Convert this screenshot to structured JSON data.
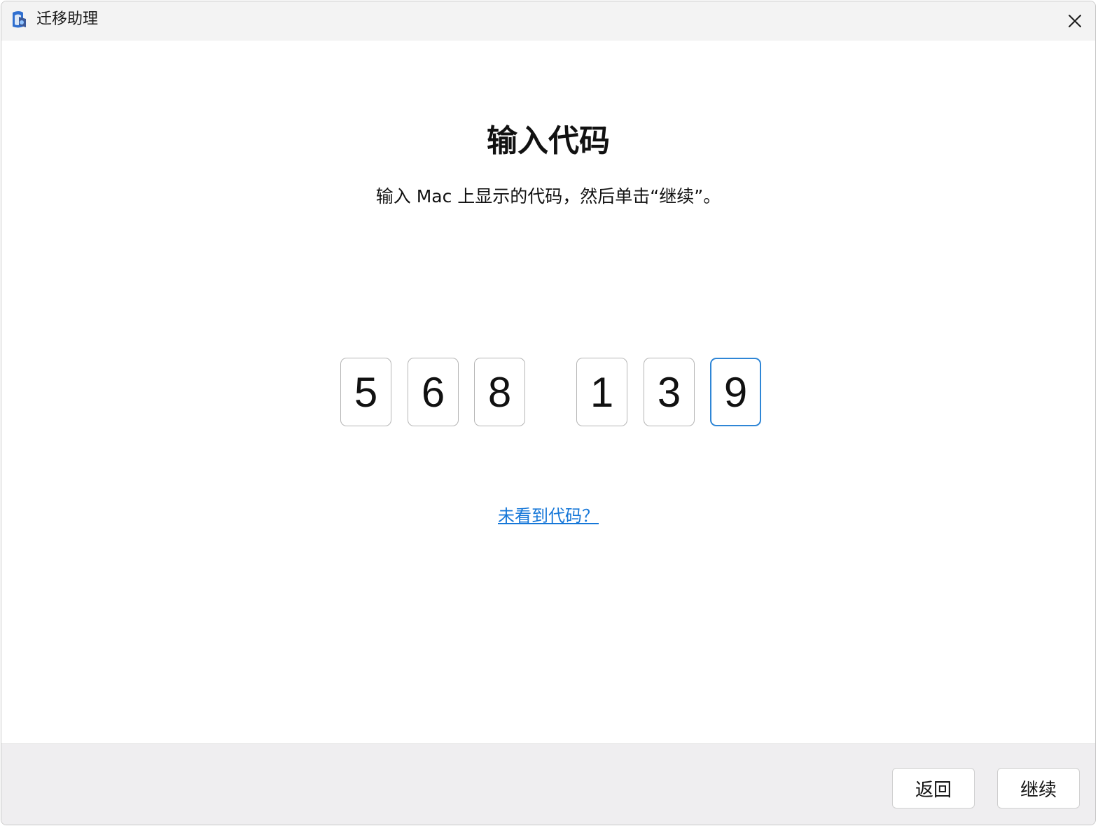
{
  "window": {
    "title": "迁移助理"
  },
  "main": {
    "heading": "输入代码",
    "instruction": "输入 Mac 上显示的代码，然后单击“继续”。",
    "code_digits": [
      "5",
      "6",
      "8",
      "1",
      "3",
      "9"
    ],
    "help_link": "未看到代码？"
  },
  "footer": {
    "back_label": "返回",
    "continue_label": "继续"
  },
  "colors": {
    "accent": "#2f86d6",
    "link": "#1677d8",
    "footer_background": "#efeef0",
    "titlebar_background": "#f3f3f3"
  },
  "icons": {
    "app": "migration-assistant-icon",
    "close": "close-icon"
  }
}
